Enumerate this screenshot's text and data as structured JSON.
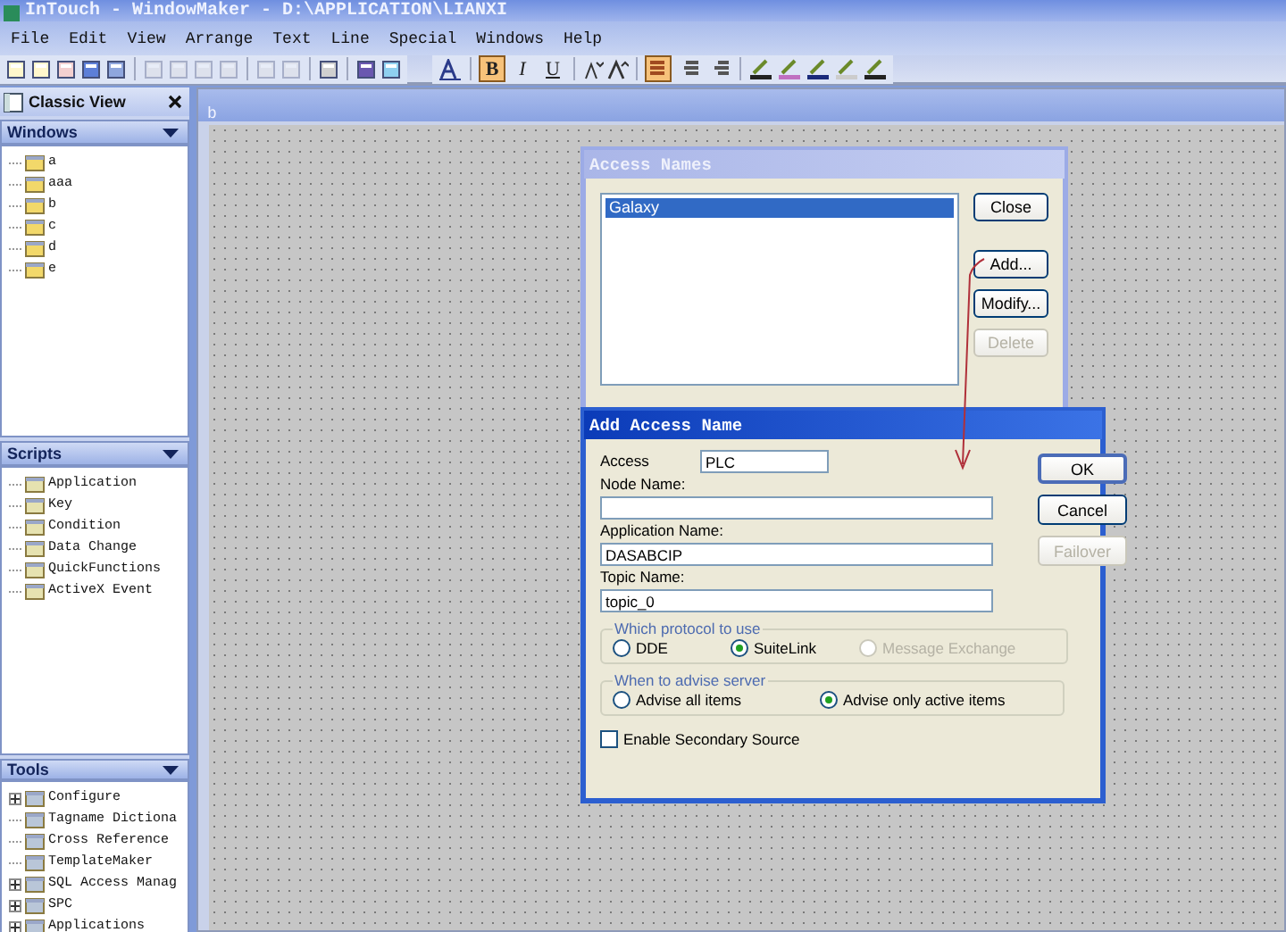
{
  "window": {
    "title": "InTouch - WindowMaker - D:\\APPLICATION\\LIANXI"
  },
  "menu": [
    "File",
    "Edit",
    "View",
    "Arrange",
    "Text",
    "Line",
    "Special",
    "Windows",
    "Help"
  ],
  "format_toolbar": {
    "text_style": [
      {
        "label": "B",
        "selected": true
      },
      {
        "label": "I",
        "selected": false
      },
      {
        "label": "U",
        "selected": false
      }
    ],
    "alignment": [
      {
        "kind": "left",
        "selected": true
      },
      {
        "kind": "center",
        "selected": false
      },
      {
        "kind": "right",
        "selected": false
      }
    ]
  },
  "sidebar": {
    "title": "Classic View",
    "sections": [
      {
        "title": "Windows",
        "kind": "windows",
        "items": [
          {
            "label": "a",
            "expandable": false
          },
          {
            "label": "aaa",
            "expandable": false
          },
          {
            "label": "b",
            "expandable": false
          },
          {
            "label": "c",
            "expandable": false
          },
          {
            "label": "d",
            "expandable": false
          },
          {
            "label": "e",
            "expandable": false
          }
        ]
      },
      {
        "title": "Scripts",
        "kind": "scripts",
        "items": [
          {
            "label": "Application",
            "expandable": false
          },
          {
            "label": "Key",
            "expandable": false
          },
          {
            "label": "Condition",
            "expandable": false
          },
          {
            "label": "Data Change",
            "expandable": false
          },
          {
            "label": "QuickFunctions",
            "expandable": false
          },
          {
            "label": "ActiveX Event",
            "expandable": false
          }
        ]
      },
      {
        "title": "Tools",
        "kind": "tools",
        "items": [
          {
            "label": "Configure",
            "expandable": true
          },
          {
            "label": "Tagname Dictiona",
            "expandable": false
          },
          {
            "label": "Cross Reference",
            "expandable": false
          },
          {
            "label": "TemplateMaker",
            "expandable": false
          },
          {
            "label": "SQL Access Manag",
            "expandable": true
          },
          {
            "label": "SPC",
            "expandable": true
          },
          {
            "label": "Applications",
            "expandable": true
          }
        ]
      }
    ]
  },
  "tab": {
    "label": "b"
  },
  "access_names": {
    "title": "Access Names",
    "items": [
      {
        "label": "Galaxy",
        "selected": true
      }
    ],
    "buttons": [
      {
        "label": "Close",
        "disabled": false
      },
      {
        "label": "Add...",
        "disabled": false
      },
      {
        "label": "Modify...",
        "disabled": false
      },
      {
        "label": "Delete",
        "disabled": true
      }
    ]
  },
  "add_access_name": {
    "title": "Add Access Name",
    "access": {
      "label": "Access",
      "value": "PLC"
    },
    "fields": [
      {
        "label": "Node Name:"
      },
      {
        "label": "Application Name:",
        "value": "DASABCIP"
      },
      {
        "label": "Topic Name:",
        "value": "topic_0"
      }
    ],
    "buttons": [
      {
        "label": "OK",
        "disabled": false,
        "default": true
      },
      {
        "label": "Cancel",
        "disabled": false,
        "default": false
      },
      {
        "label": "Failover",
        "disabled": true,
        "default": false
      }
    ],
    "groups": [
      {
        "title": "Which protocol to use",
        "options": [
          {
            "label": "DDE",
            "selected": false,
            "disabled": false
          },
          {
            "label": "SuiteLink",
            "selected": true,
            "disabled": false
          },
          {
            "label": "Message Exchange",
            "selected": false,
            "disabled": true
          }
        ]
      },
      {
        "title": "When to advise server",
        "options": [
          {
            "label": "Advise all items",
            "selected": false,
            "disabled": false
          },
          {
            "label": "Advise only active items",
            "selected": true,
            "disabled": false
          }
        ]
      }
    ],
    "secondary_source": {
      "label": "Enable Secondary Source",
      "checked": false
    }
  }
}
